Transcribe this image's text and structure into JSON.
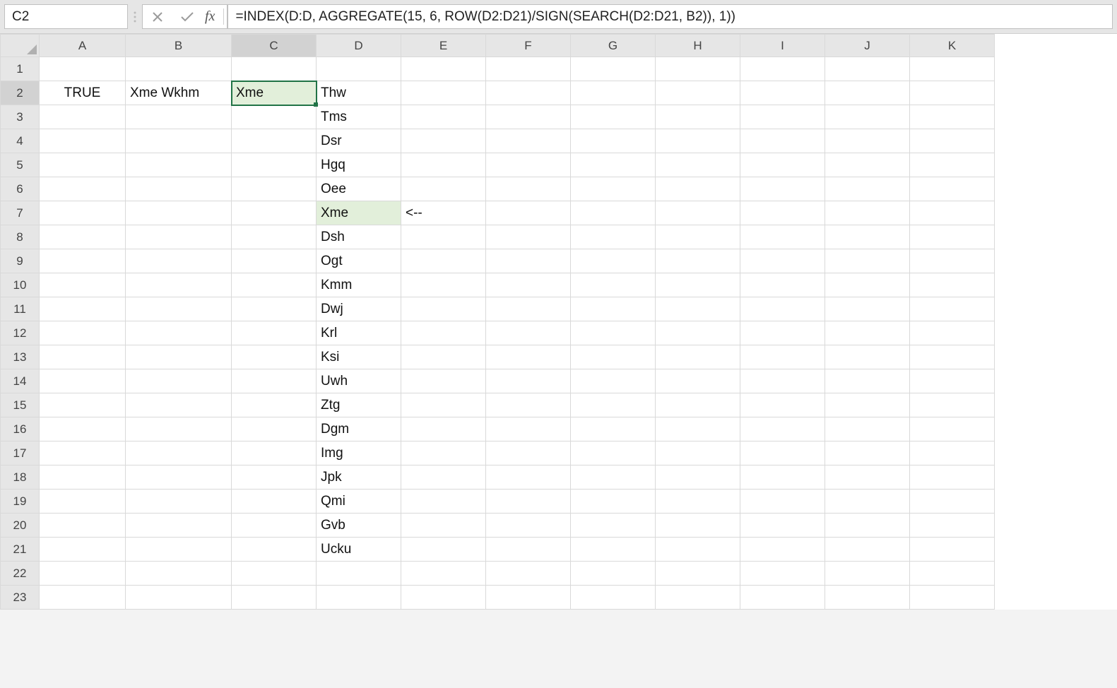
{
  "name_box": {
    "value": "C2"
  },
  "formula_bar": {
    "fx_label": "fx",
    "formula": "=INDEX(D:D, AGGREGATE(15, 6, ROW(D2:D21)/SIGN(SEARCH(D2:D21, B2)), 1))"
  },
  "columns": [
    "A",
    "B",
    "C",
    "D",
    "E",
    "F",
    "G",
    "H",
    "I",
    "J",
    "K"
  ],
  "active_column_index": 2,
  "rows": [
    1,
    2,
    3,
    4,
    5,
    6,
    7,
    8,
    9,
    10,
    11,
    12,
    13,
    14,
    15,
    16,
    17,
    18,
    19,
    20,
    21,
    22,
    23
  ],
  "active_row_index": 1,
  "cells": {
    "A2": "TRUE",
    "B2": "Xme Wkhm",
    "C2": "Xme",
    "D2": "Thw",
    "D3": "Tms",
    "D4": "Dsr",
    "D5": "Hgq",
    "D6": "Oee",
    "D7": "Xme",
    "E7": "<--",
    "D8": "Dsh",
    "D9": "Ogt",
    "D10": "Kmm",
    "D11": "Dwj",
    "D12": "Krl",
    "D13": "Ksi",
    "D14": "Uwh",
    "D15": "Ztg",
    "D16": "Dgm",
    "D17": "Img",
    "D18": "Jpk",
    "D19": "Qmi",
    "D20": "Gvb",
    "D21": "Ucku"
  },
  "highlighted_cells": [
    "C2",
    "D7"
  ],
  "active_cell": "C2",
  "icons": {
    "dropdown": "chevron-down-icon",
    "cancel": "cancel-icon",
    "enter": "check-icon",
    "fx": "fx-icon",
    "dots": "more-icon"
  }
}
